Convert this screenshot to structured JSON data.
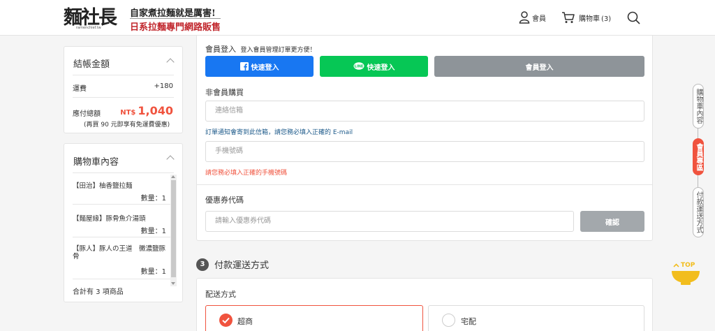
{
  "header": {
    "logo_text": "麵社長",
    "logo_sub": "ramenchief.tw",
    "slogan_line1": "自家煮拉麵就是厲害!",
    "slogan_line2": "日系拉麵專門網路販售",
    "member_label": "會員",
    "cart_label": "購物車",
    "cart_count": "(3)"
  },
  "summary": {
    "title": "結帳金額",
    "shipping_label": "運費",
    "shipping_value": "+180",
    "total_label": "應付總額",
    "currency": "NT$",
    "total_value": "1,040",
    "free_shipping_note": "(再買 90 元即享有免運費優惠)"
  },
  "cart": {
    "title": "購物車內容",
    "items": [
      {
        "name": "【田治】柚香鹽拉麵",
        "qty": "數量：1"
      },
      {
        "name": "【麵屋緣】豚骨魚介湯頭",
        "qty": "數量：1"
      },
      {
        "name": "【豚人】豚人の王道　黴濃鹽豚骨",
        "qty": "數量：1"
      }
    ],
    "total_count": "合計有 3 項商品"
  },
  "login": {
    "title": "會員登入",
    "subtitle": "登入會員管理訂單更方便！",
    "facebook_btn": "快速登入",
    "line_btn": "快速登入",
    "member_btn": "會員登入"
  },
  "guest": {
    "title": "非會員購買",
    "email_placeholder": "連絡信箱",
    "email_note": "訂單通知會寄到此信箱，請您務必填入正確的 E-mail",
    "phone_placeholder": "手機號碼",
    "phone_error": "請您務必填入正確的手機號碼"
  },
  "coupon": {
    "title": "優惠券代碼",
    "placeholder": "請輸入優惠券代碼",
    "confirm_btn": "確認"
  },
  "payment": {
    "step": "3",
    "title": "付款運送方式",
    "delivery_title": "配送方式",
    "option_store": "超商",
    "option_home": "宅配"
  },
  "sidenav": {
    "item1": "購物車內容",
    "item2": "會員專區",
    "item3": "付款運送方式"
  },
  "top_label": "TOP",
  "colors": {
    "accent": "#f0533e",
    "facebook": "#1877f2",
    "line": "#06c755",
    "gray_btn": "#8e9499",
    "top_bowl": "#f2bd1d"
  }
}
